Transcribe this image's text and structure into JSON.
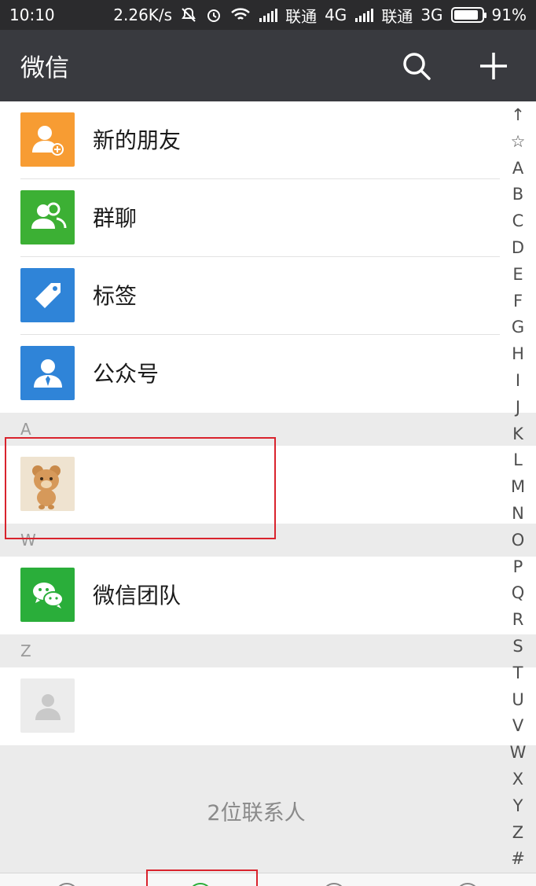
{
  "status_bar": {
    "time": "10:10",
    "speed": "2.26K/s",
    "carrier1": "联通",
    "net1": "4G",
    "carrier2": "联通",
    "net2": "3G",
    "battery": "91%",
    "battery_level": 0.91
  },
  "header": {
    "title": "微信",
    "search_icon": "search-icon",
    "add_icon": "plus-icon"
  },
  "functions": [
    {
      "label": "新的朋友",
      "icon": "add-friend-icon",
      "color": "#f79c33"
    },
    {
      "label": "群聊",
      "icon": "group-chat-icon",
      "color": "#3cb034"
    },
    {
      "label": "标签",
      "icon": "tag-icon",
      "color": "#2f84d8"
    },
    {
      "label": "公众号",
      "icon": "official-account-icon",
      "color": "#2f84d8"
    }
  ],
  "sections": {
    "a": {
      "letter": "A"
    },
    "w": {
      "letter": "W",
      "contact": "微信团队"
    },
    "z": {
      "letter": "Z"
    }
  },
  "footer": {
    "count": "2位联系人"
  },
  "index": [
    "↑",
    "☆",
    "A",
    "B",
    "C",
    "D",
    "E",
    "F",
    "G",
    "H",
    "I",
    "J",
    "K",
    "L",
    "M",
    "N",
    "O",
    "P",
    "Q",
    "R",
    "S",
    "T",
    "U",
    "V",
    "W",
    "X",
    "Y",
    "Z",
    "#"
  ],
  "colors": {
    "header_bg": "#393a3f",
    "statusbar_bg": "#2b2b2d",
    "highlight": "#d9232d",
    "wechat_green": "#2aae3a"
  }
}
